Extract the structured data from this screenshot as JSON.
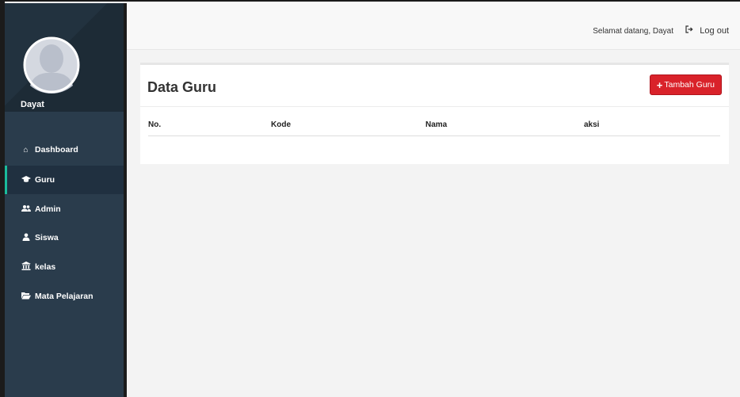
{
  "sidebar": {
    "profile": {
      "name": "Dayat",
      "avatar": "user-silhouette-icon"
    },
    "items": [
      {
        "label": "Dashboard",
        "icon": "home-icon",
        "active": false
      },
      {
        "label": "Guru",
        "icon": "graduation-cap-icon",
        "active": true
      },
      {
        "label": "Admin",
        "icon": "users-icon",
        "active": false
      },
      {
        "label": "Siswa",
        "icon": "user-icon",
        "active": false
      },
      {
        "label": "kelas",
        "icon": "bank-icon",
        "active": false
      },
      {
        "label": "Mata Pelajaran",
        "icon": "folder-open-icon",
        "active": false
      }
    ]
  },
  "topbar": {
    "welcome": "Selamat datang, Dayat",
    "logout_label": "Log out"
  },
  "panel": {
    "title": "Data Guru",
    "add_button_label": "Tambah Guru",
    "columns": [
      "No.",
      "Kode",
      "Nama",
      "aksi"
    ],
    "rows": []
  },
  "colors": {
    "sidebar_bg": "#2a3c4c",
    "active_accent": "#1abc9c",
    "button_red": "#d9222a",
    "content_bg": "#f3f3f3"
  }
}
